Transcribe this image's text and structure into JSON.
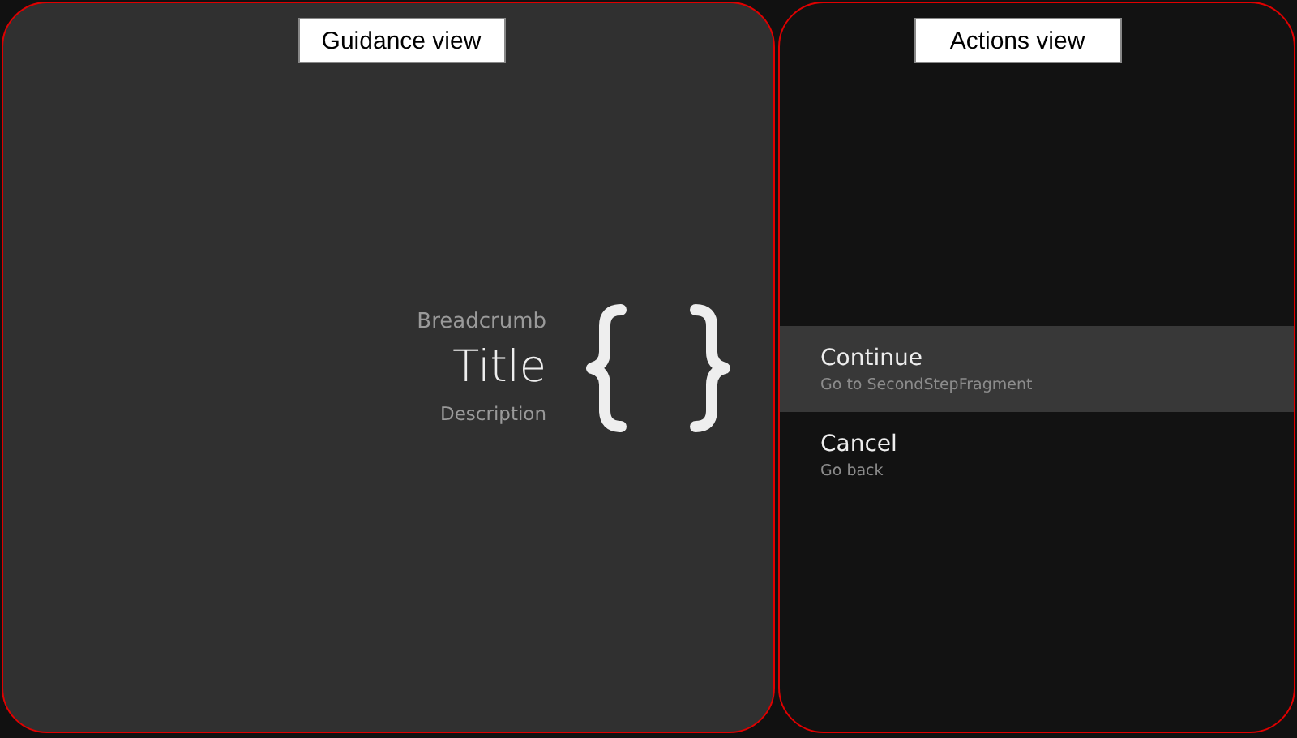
{
  "guidance": {
    "label": "Guidance view",
    "breadcrumb": "Breadcrumb",
    "title": "Title",
    "description": "Description"
  },
  "actions_panel": {
    "label": "Actions view",
    "actions": [
      {
        "title": "Continue",
        "description": "Go to SecondStepFragment",
        "selected": true
      },
      {
        "title": "Cancel",
        "description": "Go back",
        "selected": false
      }
    ]
  }
}
